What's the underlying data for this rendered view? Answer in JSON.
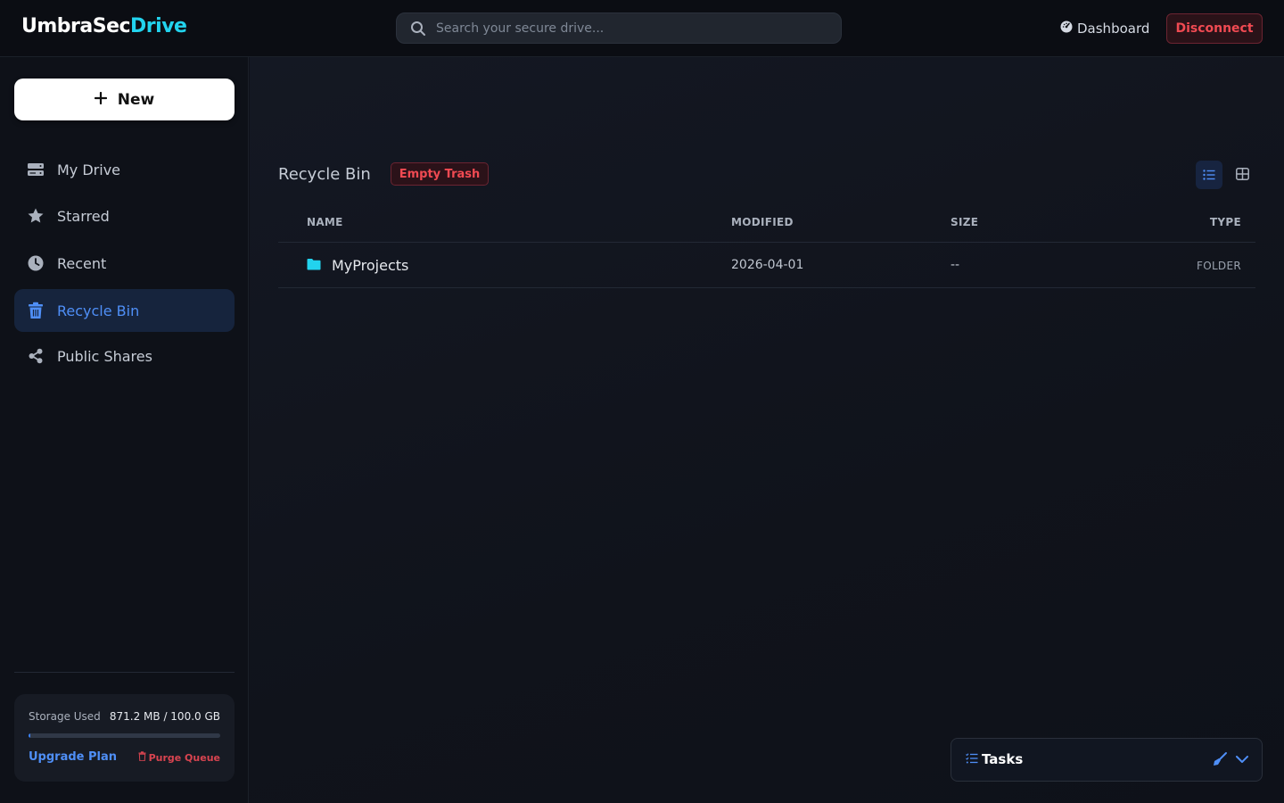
{
  "header": {
    "logo_primary": "UmbraSec",
    "logo_accent": "Drive",
    "search_placeholder": "Search your secure drive...",
    "dashboard_label": "Dashboard",
    "disconnect_label": "Disconnect"
  },
  "sidebar": {
    "new_label": "New",
    "items": [
      {
        "label": "My Drive",
        "icon": "drive-icon",
        "active": false
      },
      {
        "label": "Starred",
        "icon": "star-icon",
        "active": false
      },
      {
        "label": "Recent",
        "icon": "clock-icon",
        "active": false
      },
      {
        "label": "Recycle Bin",
        "icon": "trash-icon",
        "active": true
      },
      {
        "label": "Public Shares",
        "icon": "share-icon",
        "active": false
      }
    ],
    "storage": {
      "label": "Storage Used",
      "value": "871.2 MB / 100.0 GB",
      "used_fraction": 0.0087,
      "upgrade_label": "Upgrade Plan",
      "purge_label": "Purge Queue"
    }
  },
  "main": {
    "title": "Recycle Bin",
    "empty_trash_label": "Empty Trash",
    "columns": {
      "name": "NAME",
      "modified": "MODIFIED",
      "size": "SIZE",
      "type": "TYPE"
    },
    "rows": [
      {
        "name": "MyProjects",
        "modified": "2026-04-01",
        "size": "--",
        "type": "FOLDER",
        "icon": "folder-icon"
      }
    ]
  },
  "tasks": {
    "label": "Tasks"
  },
  "colors": {
    "accent": "#3b82f6",
    "brand_accent": "#22d3ee",
    "danger": "#f04a52",
    "folder": "#22d3ee"
  }
}
